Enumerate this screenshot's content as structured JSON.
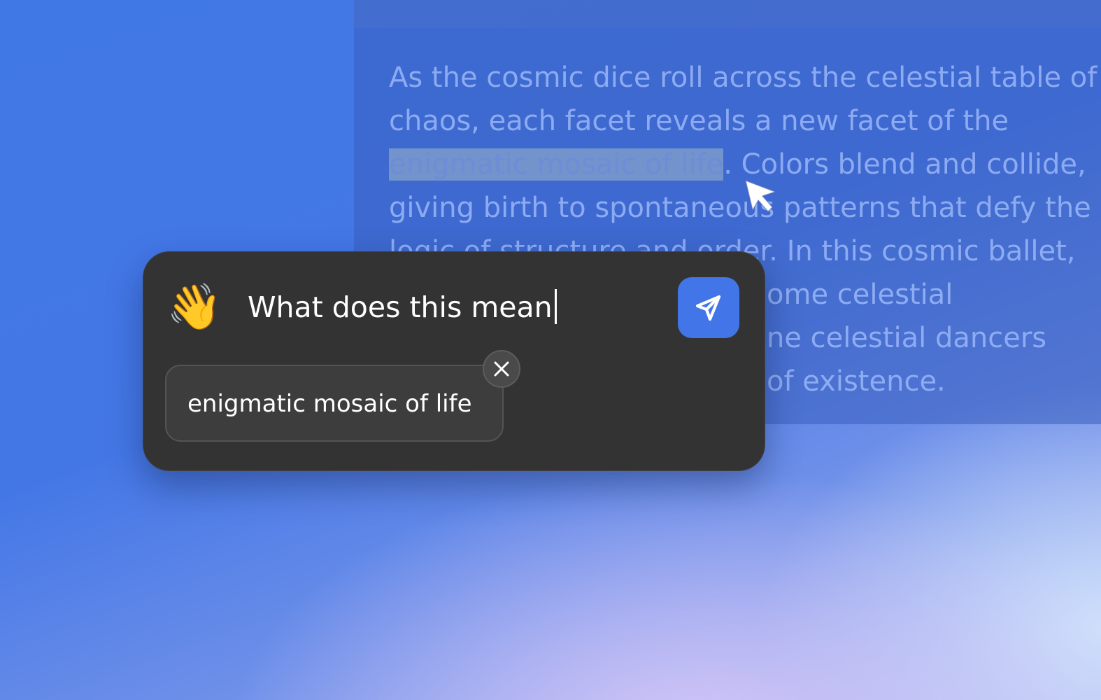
{
  "document": {
    "lines": [
      "As the cosmic dice roll across the celestial table of",
      "chaos, each facet reveals a new facet of the",
      "",
      "giving birth to spontaneous patterns that defy the",
      "logic of structure and order. In this cosmic ballet,",
      "ome celestial",
      "ne celestial dancers",
      "of existence."
    ],
    "highlighted_text": "enigmatic mosaic of life",
    "after_highlight": ". Colors blend and collide,"
  },
  "popup": {
    "emoji": "👋",
    "prompt_text": "What does this mean",
    "send_icon": "send-icon",
    "chip_text": "enigmatic mosaic of life",
    "chip_close_icon": "close-icon"
  },
  "colors": {
    "popup_bg": "#333333",
    "accent": "#4276e8",
    "background_blue": "#4078e6"
  }
}
